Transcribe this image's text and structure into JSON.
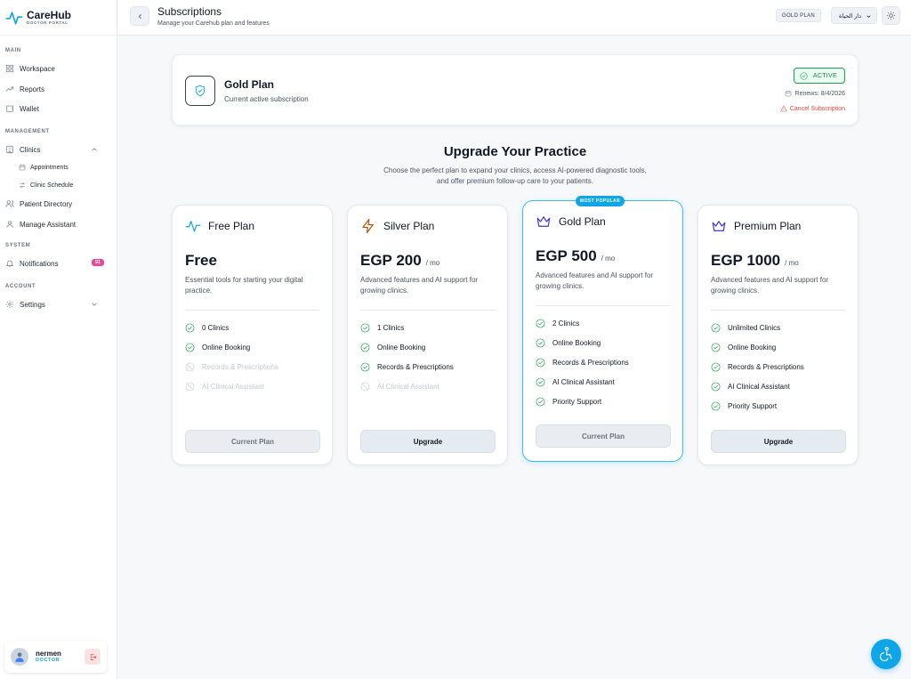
{
  "brand": {
    "name": "CareHub",
    "sub": "DOCTOR PORTAL"
  },
  "sidebar": {
    "sections": {
      "main": "MAIN",
      "management": "MANAGEMENT",
      "system": "SYSTEM",
      "account": "ACCOUNT"
    },
    "items": {
      "workspace": "Workspace",
      "reports": "Reports",
      "wallet": "Wallet",
      "clinics": "Clinics",
      "appointments": "Appointments",
      "clinic_schedule": "Clinic Schedule",
      "patient_directory": "Patient Directory",
      "manage_assistant": "Manage Assistant",
      "notifications": "Notifications",
      "notifications_count": "91",
      "settings": "Settings"
    },
    "user": {
      "name": "nermen",
      "role": "DOCTOR"
    }
  },
  "header": {
    "title": "Subscriptions",
    "subtitle": "Manage your Carehub plan and features",
    "plan_chip": "GOLD PLAN",
    "language": "دار الحياة"
  },
  "current_plan": {
    "name": "Gold Plan",
    "subtitle": "Current active subscription",
    "status": "ACTIVE",
    "renews": "Renews: 8/4/2026",
    "cancel": "Cancel Subscription"
  },
  "upgrade": {
    "title": "Upgrade Your Practice",
    "desc_line1": "Choose the perfect plan to expand your clinics, access AI-powered diagnostic tools,",
    "desc_line2": "and offer premium follow-up care to your patients."
  },
  "plans": [
    {
      "name": "Free Plan",
      "price": "Free",
      "per": "",
      "desc": "Essential tools for starting your digital practice.",
      "features": [
        "0 Clinics",
        "Online Booking",
        "Records & Prescriptions",
        "AI Clinical Assistant"
      ],
      "included": [
        true,
        true,
        false,
        false
      ],
      "button": "Current Plan"
    },
    {
      "name": "Silver Plan",
      "price": "EGP 200",
      "per": "/ mo",
      "desc": "Advanced features and AI support for growing clinics.",
      "features": [
        "1 Clinics",
        "Online Booking",
        "Records & Prescriptions",
        "AI Clinical Assistant"
      ],
      "included": [
        true,
        true,
        true,
        false
      ],
      "button": "Upgrade"
    },
    {
      "name": "Gold Plan",
      "price": "EGP 500",
      "per": "/ mo",
      "tag": "MOST POPULAR",
      "desc": "Advanced features and AI support for growing clinics.",
      "features": [
        "2 Clinics",
        "Online Booking",
        "Records & Prescriptions",
        "AI Clinical Assistant",
        "Priority Support"
      ],
      "included": [
        true,
        true,
        true,
        true,
        true
      ],
      "button": "Current Plan"
    },
    {
      "name": "Premium Plan",
      "price": "EGP 1000",
      "per": "/ mo",
      "desc": "Advanced features and AI support for growing clinics.",
      "features": [
        "Unlimited Clinics",
        "Online Booking",
        "Records & Prescriptions",
        "AI Clinical Assistant",
        "Priority Support"
      ],
      "included": [
        true,
        true,
        true,
        true,
        true
      ],
      "button": "Upgrade"
    }
  ],
  "colors": {
    "accent": "#0ea5e9",
    "success": "#16a34a",
    "danger": "#ef4444",
    "badge": "#ec4899"
  }
}
